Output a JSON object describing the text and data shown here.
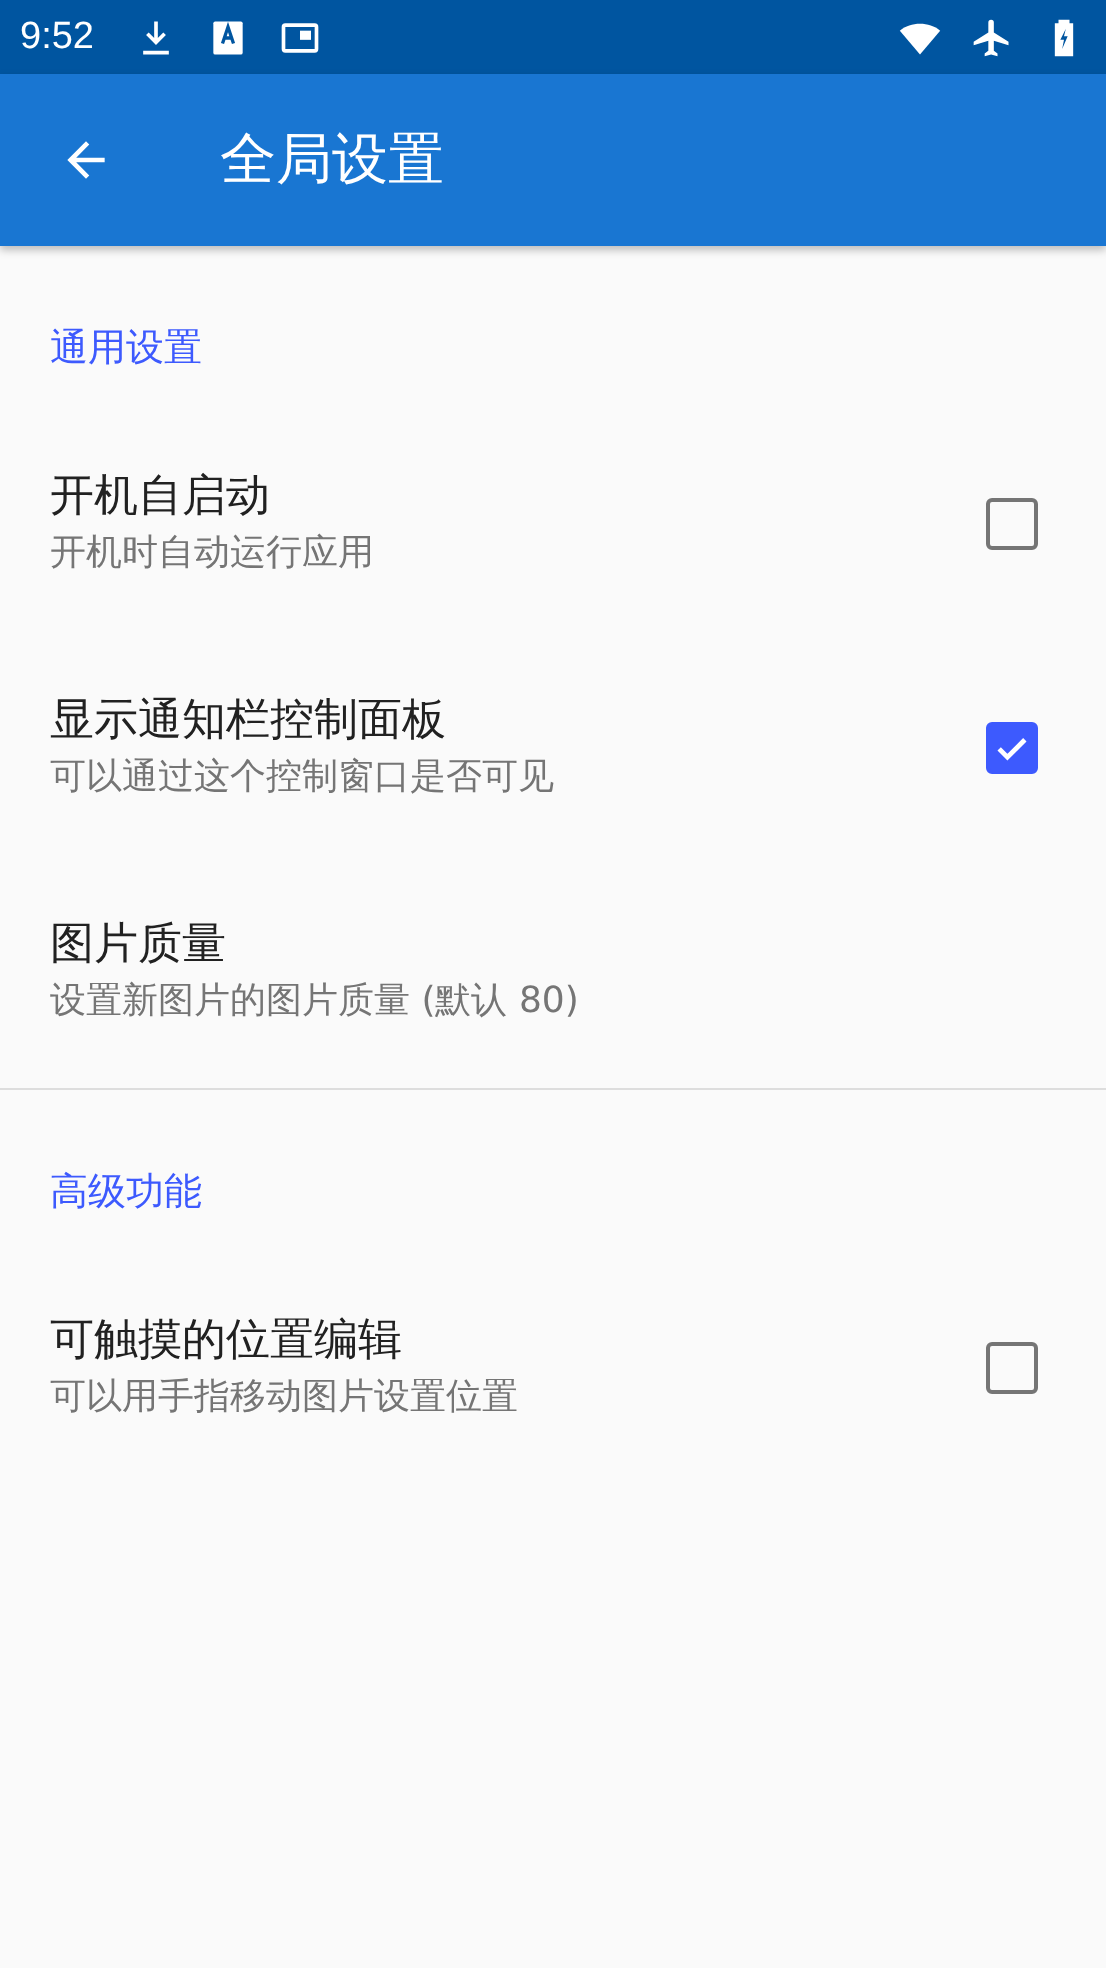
{
  "status_bar": {
    "time": "9:52"
  },
  "app_bar": {
    "title": "全局设置"
  },
  "sections": [
    {
      "header": "通用设置",
      "items": [
        {
          "kind": "checkbox",
          "title": "开机自启动",
          "summary": "开机时自动运行应用",
          "checked": false
        },
        {
          "kind": "checkbox",
          "title": "显示通知栏控制面板",
          "summary": "可以通过这个控制窗口是否可见",
          "checked": true
        },
        {
          "kind": "plain",
          "title": "图片质量",
          "summary": "设置新图片的图片质量 (默认 80)"
        }
      ]
    },
    {
      "header": "高级功能",
      "items": [
        {
          "kind": "checkbox",
          "title": "可触摸的位置编辑",
          "summary": "可以用手指移动图片设置位置",
          "checked": false
        }
      ]
    }
  ]
}
